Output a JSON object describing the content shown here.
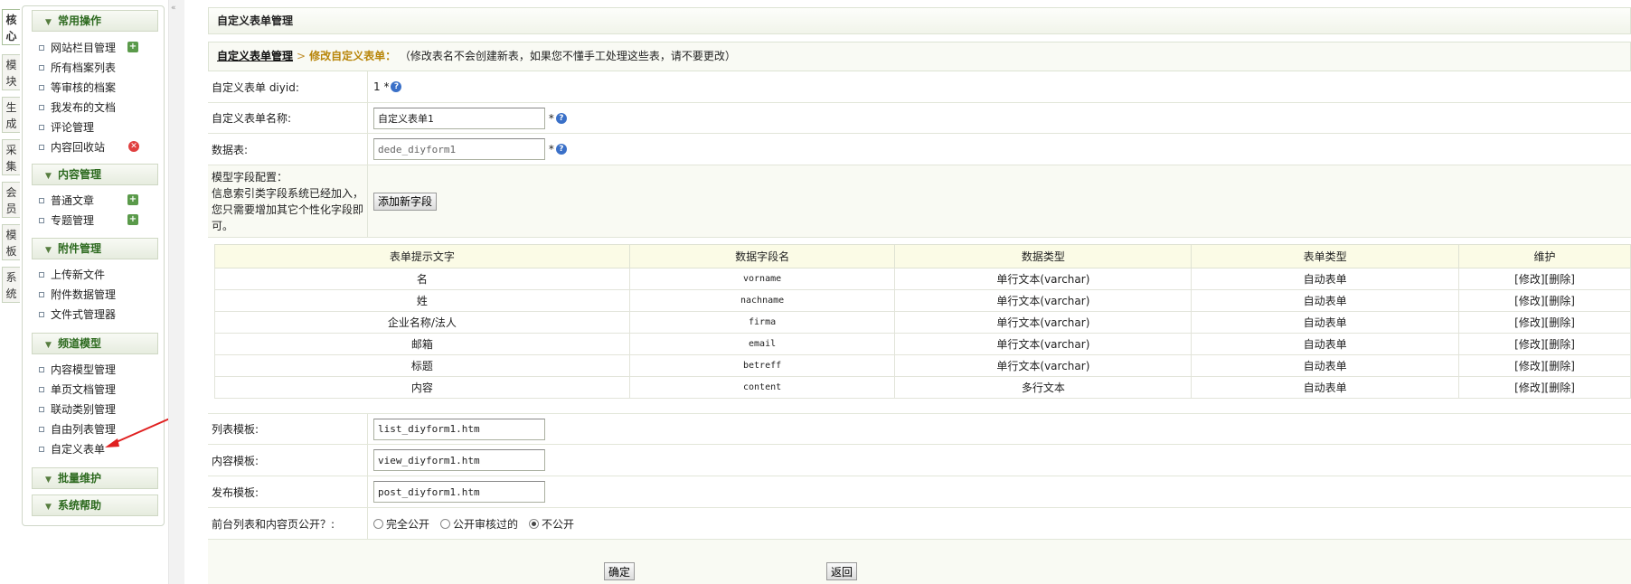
{
  "vertical_tabs": [
    "核心",
    "模块",
    "生成",
    "采集",
    "会员",
    "模板",
    "系统"
  ],
  "menu": {
    "groups": [
      {
        "title": "常用操作",
        "items": [
          "网站栏目管理",
          "所有档案列表",
          "等审核的档案",
          "我发布的文档",
          "评论管理",
          "内容回收站"
        ]
      },
      {
        "title": "内容管理",
        "items": [
          "普通文章",
          "专题管理"
        ]
      },
      {
        "title": "附件管理",
        "items": [
          "上传新文件",
          "附件数据管理",
          "文件式管理器"
        ]
      },
      {
        "title": "频道模型",
        "items": [
          "内容模型管理",
          "单页文档管理",
          "联动类别管理",
          "自由列表管理",
          "自定义表单"
        ]
      },
      {
        "title": "批量维护",
        "items": []
      },
      {
        "title": "系统帮助",
        "items": []
      }
    ]
  },
  "page_title": "自定义表单管理",
  "breadcrumb": {
    "link": "自定义表单管理",
    "sep": ">",
    "current": "修改自定义表单：",
    "note": "（修改表名不会创建新表，如果您不懂手工处理这些表，请不要更改）"
  },
  "form": {
    "diyid_label": "自定义表单 diyid:",
    "diyid_value": "1",
    "required_mark": "*",
    "name_label": "自定义表单名称:",
    "name_value": "自定义表单1",
    "table_label": "数据表:",
    "table_value": "dede_diyform1",
    "model_label_1": "模型字段配置：",
    "model_label_2": "信息索引类字段系统已经加入，",
    "model_label_3": "您只需要增加其它个性化字段即",
    "model_label_4": "可。",
    "add_field_button": "添加新字段",
    "list_tpl_label": "列表模板:",
    "list_tpl_value": "list_diyform1.htm",
    "view_tpl_label": "内容模板:",
    "view_tpl_value": "view_diyform1.htm",
    "post_tpl_label": "发布模板:",
    "post_tpl_value": "post_diyform1.htm",
    "public_label": "前台列表和内容页公开？:",
    "public_options": [
      "完全公开",
      "公开审核过的",
      "不公开"
    ],
    "public_selected": 2,
    "ok_button": "确定",
    "back_button": "返回",
    "help_glyph": "?"
  },
  "fields_table": {
    "headers": [
      "表单提示文字",
      "数据字段名",
      "数据类型",
      "表单类型",
      "维护"
    ],
    "rows": [
      [
        "名",
        "vorname",
        "单行文本(varchar)",
        "自动表单",
        "[修改][删除]"
      ],
      [
        "姓",
        "nachname",
        "单行文本(varchar)",
        "自动表单",
        "[修改][删除]"
      ],
      [
        "企业名称/法人",
        "firma",
        "单行文本(varchar)",
        "自动表单",
        "[修改][删除]"
      ],
      [
        "邮箱",
        "email",
        "单行文本(varchar)",
        "自动表单",
        "[修改][删除]"
      ],
      [
        "标题",
        "betreff",
        "单行文本(varchar)",
        "自动表单",
        "[修改][删除]"
      ],
      [
        "内容",
        "content",
        "多行文本",
        "自动表单",
        "[修改][删除]"
      ]
    ]
  }
}
